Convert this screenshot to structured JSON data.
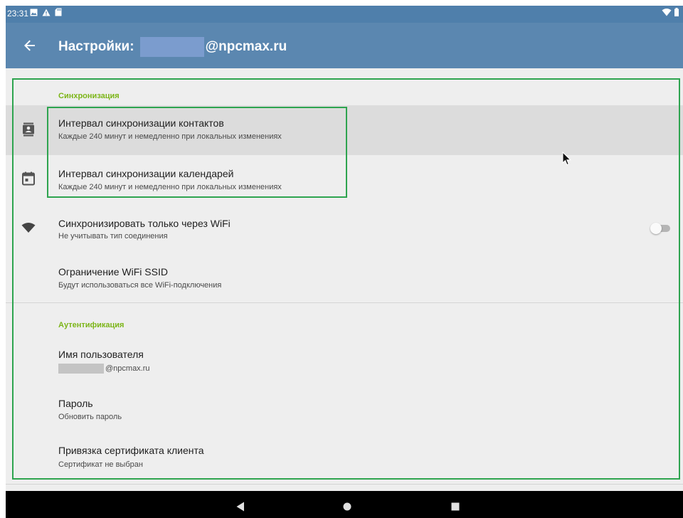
{
  "status_bar": {
    "time": "23:31",
    "icons": [
      "image-icon",
      "warning-icon",
      "sd-card-icon"
    ],
    "right_icons": [
      "wifi-icon",
      "battery-icon"
    ]
  },
  "app_bar": {
    "title_prefix": "Настройки:",
    "title_suffix": "@npcmax.ru",
    "color": "#5b87b0"
  },
  "sections": {
    "sync": {
      "header": "Синхронизация",
      "contacts_interval": {
        "title": "Интервал синхронизации контактов",
        "summary": "Каждые 240 минут и немедленно при локальных изменениях",
        "icon": "contacts-icon"
      },
      "calendar_interval": {
        "title": "Интервал синхронизации календарей",
        "summary": "Каждые 240 минут и немедленно при локальных изменениях",
        "icon": "calendar-icon"
      },
      "wifi_only": {
        "title": "Синхронизировать только через WiFi",
        "summary": "Не учитывать тип соединения",
        "icon": "wifi-icon",
        "enabled": false
      },
      "wifi_ssid": {
        "title": "Ограничение WiFi SSID",
        "summary": "Будут использоваться все WiFi-подключения"
      }
    },
    "auth": {
      "header": "Аутентификация",
      "username": {
        "title": "Имя пользователя",
        "summary": "@npcmax.ru"
      },
      "password": {
        "title": "Пароль",
        "summary": "Обновить пароль"
      },
      "client_cert": {
        "title": "Привязка сертификата клиента",
        "summary": "Сертификат не выбран"
      }
    }
  },
  "colors": {
    "accent": "#7cb518",
    "highlight_outline": "#2ea44f"
  },
  "nav_bar": {
    "buttons": [
      "back-triangle-icon",
      "home-circle-icon",
      "recents-square-icon"
    ]
  }
}
